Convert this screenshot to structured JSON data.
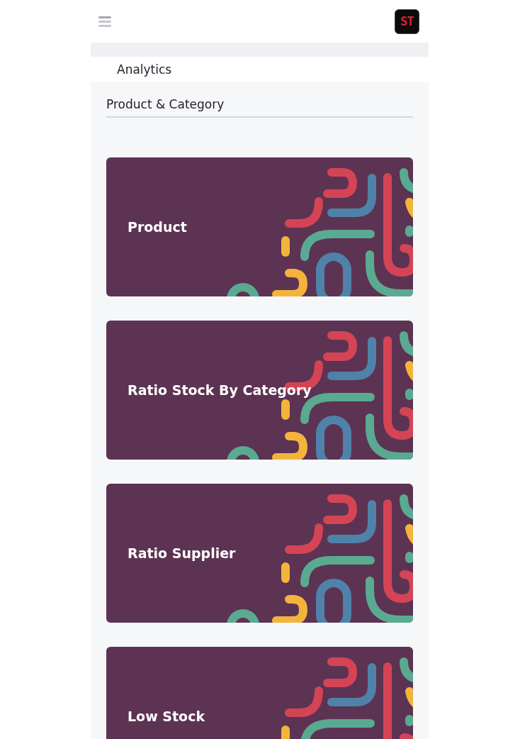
{
  "header": {
    "logo": "ST"
  },
  "page_title": "Analytics",
  "section": {
    "title": "Product & Category"
  },
  "cards": [
    {
      "title": "Product"
    },
    {
      "title": "Ratio Stock By Category"
    },
    {
      "title": "Ratio Supplier"
    },
    {
      "title": "Low Stock"
    }
  ]
}
